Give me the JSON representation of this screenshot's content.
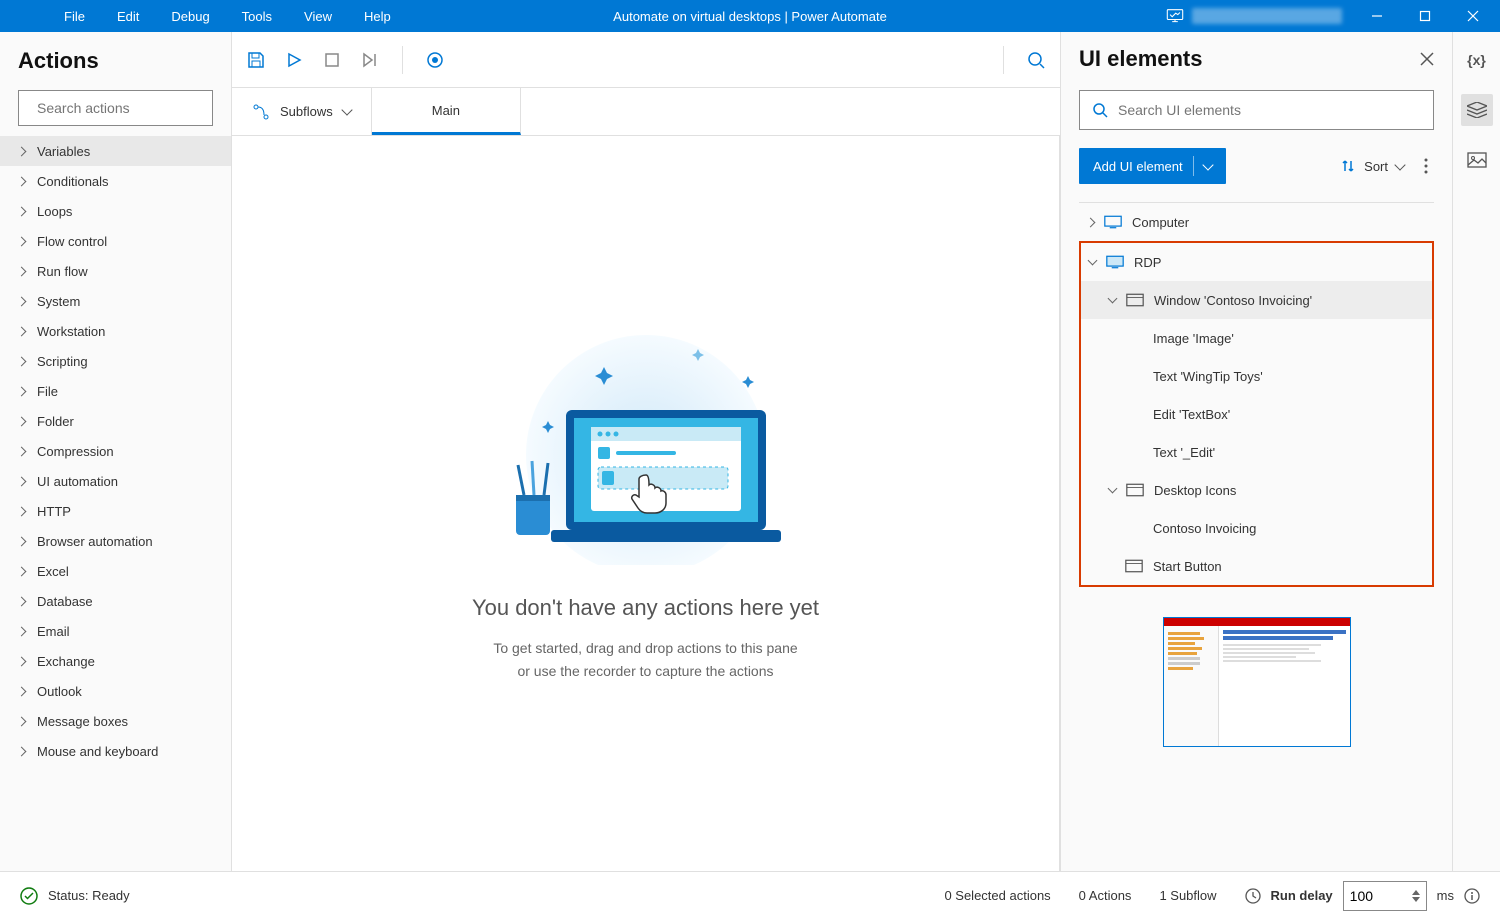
{
  "title": "Automate on virtual desktops | Power Automate",
  "menus": [
    "File",
    "Edit",
    "Debug",
    "Tools",
    "View",
    "Help"
  ],
  "actions_panel": {
    "header": "Actions",
    "search_placeholder": "Search actions",
    "items": [
      "Variables",
      "Conditionals",
      "Loops",
      "Flow control",
      "Run flow",
      "System",
      "Workstation",
      "Scripting",
      "File",
      "Folder",
      "Compression",
      "UI automation",
      "HTTP",
      "Browser automation",
      "Excel",
      "Database",
      "Email",
      "Exchange",
      "Outlook",
      "Message boxes",
      "Mouse and keyboard"
    ]
  },
  "subflows_label": "Subflows",
  "main_tab": "Main",
  "empty_state": {
    "title": "You don't have any actions here yet",
    "line1": "To get started, drag and drop actions to this pane",
    "line2": "or use the recorder to capture the actions"
  },
  "ui_panel": {
    "header": "UI elements",
    "search_placeholder": "Search UI elements",
    "add_button": "Add UI element",
    "sort_label": "Sort",
    "tree": {
      "computer": "Computer",
      "rdp": "RDP",
      "window": "Window 'Contoso Invoicing'",
      "image": "Image 'Image'",
      "text1": "Text 'WingTip Toys'",
      "edit": "Edit 'TextBox'",
      "text2": "Text '_Edit'",
      "desktop": "Desktop Icons",
      "contoso": "Contoso Invoicing",
      "start": "Start Button"
    }
  },
  "statusbar": {
    "status": "Status: Ready",
    "selected": "0 Selected actions",
    "actions": "0 Actions",
    "subflows": "1 Subflow",
    "delay_label": "Run delay",
    "delay_value": "100",
    "delay_unit": "ms"
  }
}
